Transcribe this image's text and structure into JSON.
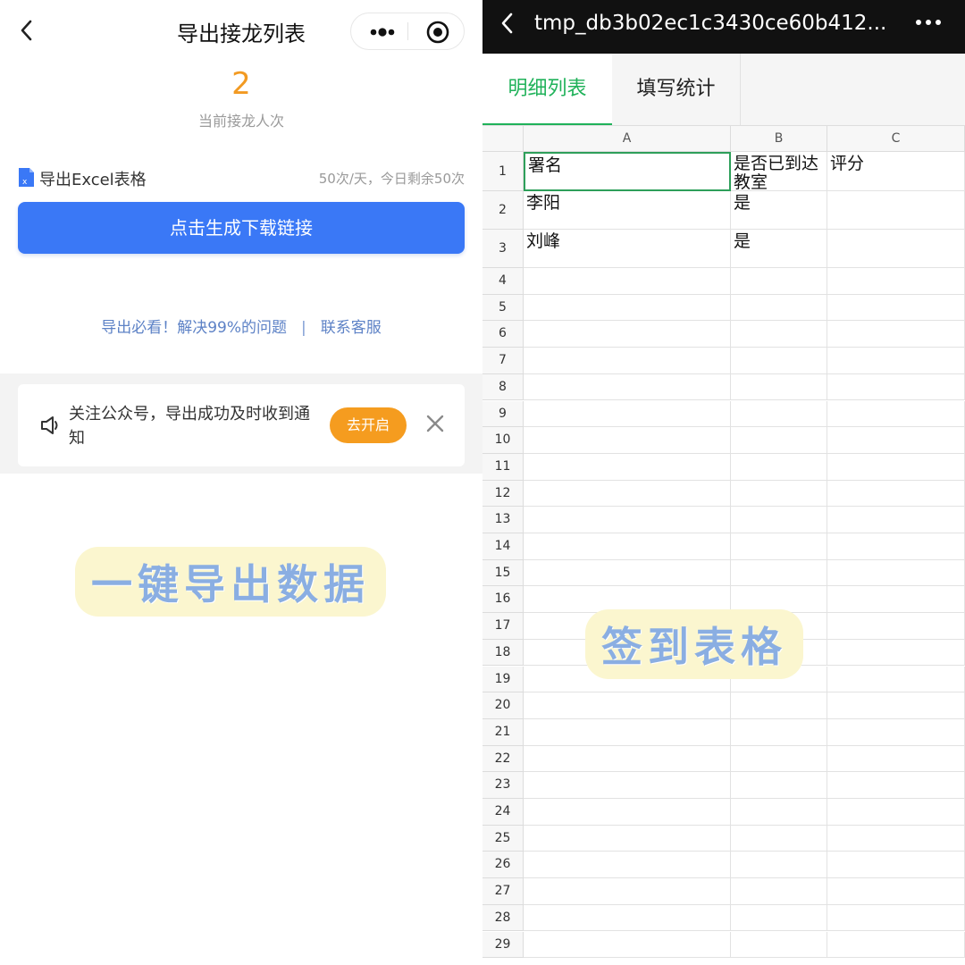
{
  "left": {
    "nav": {
      "title": "导出接龙列表",
      "back_icon": "chevron-left-icon",
      "more_icon": "more-dots-icon",
      "close_icon": "target-close-icon"
    },
    "count": {
      "value": "2",
      "label": "当前接龙人次"
    },
    "excel": {
      "icon": "excel-file-icon",
      "label": "导出Excel表格",
      "quota": "50次/天，今日剩余50次"
    },
    "generate_button": "点击生成下载链接",
    "help": {
      "guide_link": "导出必看！解决99%的问题",
      "separator": "|",
      "service_link": "联系客服"
    },
    "notice": {
      "icon": "speaker-icon",
      "text": "关注公众号，导出成功及时收到通知",
      "button": "去开启",
      "close_icon": "close-icon"
    },
    "overlay_text": "一键导出数据",
    "colors": {
      "accent_orange": "#f29a22",
      "primary_blue": "#3a78f6",
      "link_blue": "#5d82c6"
    }
  },
  "right": {
    "header": {
      "title": "tmp_db3b02ec1c3430ce60b412...",
      "back_icon": "chevron-left-icon",
      "more_icon": "more-dots-icon"
    },
    "tabs": [
      {
        "label": "明细列表",
        "active": true
      },
      {
        "label": "填写统计",
        "active": false
      }
    ],
    "sheet": {
      "columns": [
        "A",
        "B",
        "C"
      ],
      "row_numbers": [
        "1",
        "2",
        "3",
        "4",
        "5",
        "6",
        "7",
        "8",
        "9",
        "10",
        "11",
        "12",
        "13",
        "14",
        "15",
        "16",
        "17",
        "18",
        "19",
        "20",
        "21",
        "22",
        "23",
        "24",
        "25",
        "26",
        "27",
        "28",
        "29"
      ],
      "rows": [
        {
          "A": "署名",
          "B": "是否已到达教室",
          "C": "评分"
        },
        {
          "A": "李阳",
          "B": "是",
          "C": ""
        },
        {
          "A": "刘峰",
          "B": "是",
          "C": ""
        }
      ],
      "selected_cell": "A1"
    },
    "overlay_text": "签到表格",
    "colors": {
      "tab_active": "#20b25a",
      "header_bg": "#111111"
    }
  }
}
